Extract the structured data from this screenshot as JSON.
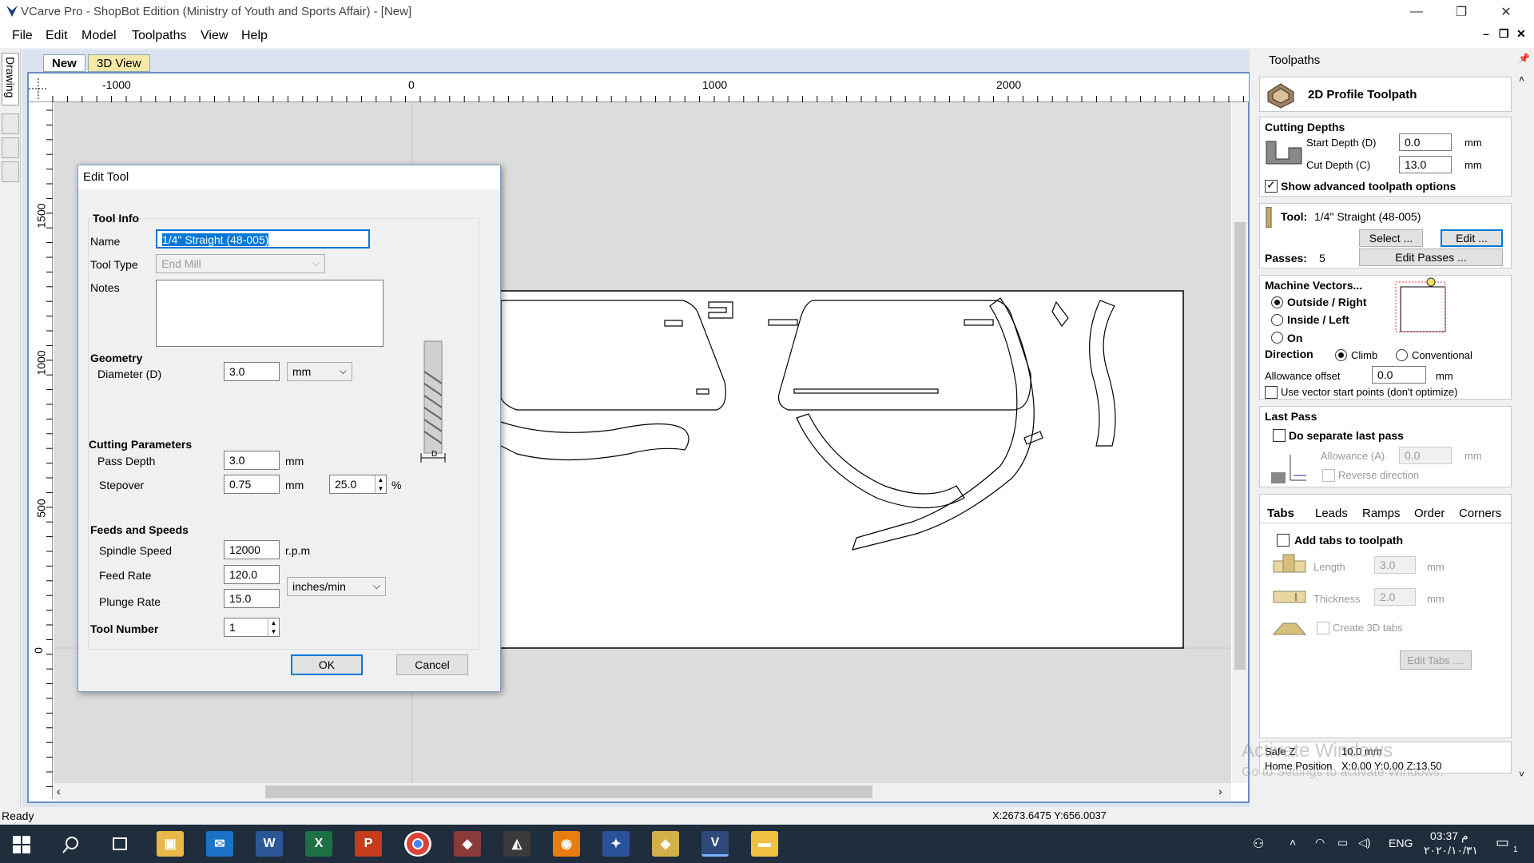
{
  "window": {
    "title": "VCarve Pro - ShopBot Edition (Ministry of Youth and Sports Affair) - [New]",
    "minimize": "—",
    "restore": "❐",
    "close": "✕"
  },
  "menu": {
    "items": [
      "File",
      "Edit",
      "Model",
      "Toolpaths",
      "View",
      "Help"
    ]
  },
  "mdi": {
    "minimize": "–",
    "restore": "❐",
    "close": "✕"
  },
  "left_strip": {
    "drawing_tab": "Drawing"
  },
  "doc_tabs": {
    "new": "New",
    "view3d": "3D View"
  },
  "ruler": {
    "top_labels": [
      "-1000",
      "0",
      "1000",
      "2000"
    ],
    "left_labels": [
      "1500",
      "1000",
      "500",
      "0"
    ]
  },
  "status": {
    "text": "Ready",
    "coords": "X:2673.6475 Y:656.0037"
  },
  "dialog": {
    "title": "Edit Tool",
    "tool_info": "Tool Info",
    "name_label": "Name",
    "name_value": "1/4\" Straight  (48-005)",
    "tool_type_label": "Tool Type",
    "tool_type_value": "End Mill",
    "notes_label": "Notes",
    "notes_value": "",
    "geometry": "Geometry",
    "diameter_label": "Diameter (D)",
    "diameter_value": "3.0",
    "diameter_unit": "mm",
    "cutting_params": "Cutting Parameters",
    "pass_depth_label": "Pass Depth",
    "pass_depth_value": "3.0",
    "pass_depth_unit": "mm",
    "stepover_label": "Stepover",
    "stepover_value": "0.75",
    "stepover_unit": "mm",
    "stepover_pct": "25.0",
    "pct_sign": "%",
    "feeds": "Feeds and Speeds",
    "spindle_label": "Spindle Speed",
    "spindle_value": "12000",
    "spindle_unit": "r.p.m",
    "feed_label": "Feed Rate",
    "feed_value": "120.0",
    "plunge_label": "Plunge Rate",
    "plunge_value": "15.0",
    "rate_unit": "inches/min",
    "tool_number_label": "Tool Number",
    "tool_number_value": "1",
    "ok": "OK",
    "cancel": "Cancel",
    "d_marker": "D"
  },
  "panel": {
    "header": "Toolpaths",
    "pin": "📌",
    "toolpath_title": "2D Profile Toolpath",
    "cutting_depths": "Cutting Depths",
    "start_depth_label": "Start Depth (D)",
    "start_depth_value": "0.0",
    "cut_depth_label": "Cut Depth (C)",
    "cut_depth_value": "13.0",
    "unit_mm": "mm",
    "show_advanced": "Show advanced toolpath options",
    "tool_label": "Tool:",
    "tool_value": "1/4\" Straight  (48-005)",
    "select_btn": "Select ...",
    "edit_btn": "Edit ...",
    "passes_label": "Passes:",
    "passes_value": "5",
    "edit_passes_btn": "Edit Passes ...",
    "machine_vectors": "Machine Vectors...",
    "outside_right": "Outside / Right",
    "inside_left": "Inside / Left",
    "on": "On",
    "direction": "Direction",
    "climb": "Climb",
    "conventional": "Conventional",
    "allowance_offset_label": "Allowance offset",
    "allowance_offset_value": "0.0",
    "use_vector_start": "Use vector start points (don't optimize)",
    "last_pass": "Last Pass",
    "do_separate": "Do separate last pass",
    "allowance_a_label": "Allowance (A)",
    "allowance_a_value": "0.0",
    "reverse_direction": "Reverse direction",
    "tabs": [
      "Tabs",
      "Leads",
      "Ramps",
      "Order",
      "Corners"
    ],
    "add_tabs": "Add tabs to toolpath",
    "length_label": "Length",
    "length_value": "3.0",
    "thickness_label": "Thickness",
    "thickness_value": "2.0",
    "create_3d_tabs": "Create 3D tabs",
    "edit_tabs_btn": "Edit Tabs ....",
    "safe_z_label": "Safe Z",
    "safe_z_value": "10.0 mm",
    "home_label": "Home Position",
    "home_value": "X:0.00 Y:0.00 Z:13.50",
    "watermark1": "Activate Windows",
    "watermark2": "Go to Settings to activate Windows."
  },
  "taskbar": {
    "time": "03:37 م",
    "date": "٢٠٢٠/١٠/٣١",
    "lang": "ENG",
    "notif_count": "1"
  }
}
